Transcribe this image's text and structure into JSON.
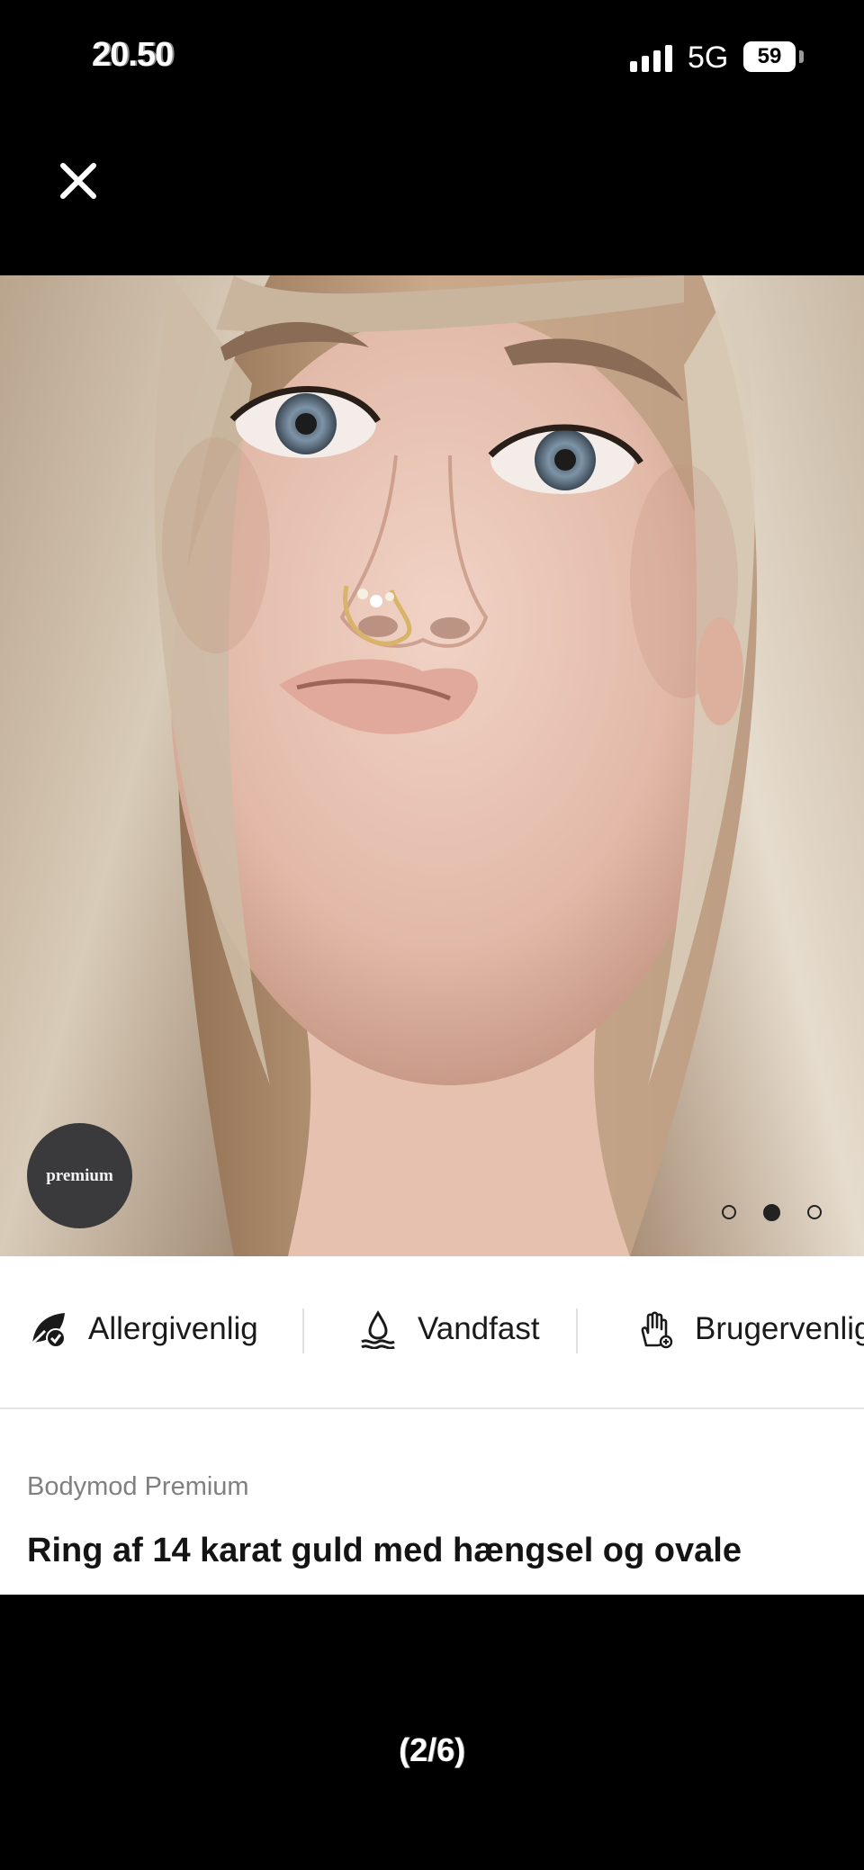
{
  "status_bar": {
    "time": "20.50",
    "network": "5G",
    "battery": "59"
  },
  "icons": {
    "close": "close-icon",
    "signal": "signal-icon",
    "battery": "battery-icon",
    "allergy": "leaf-check-icon",
    "water": "water-drop-icon",
    "hand": "hand-icon"
  },
  "gallery": {
    "badge_label": "premium",
    "current_index": 2,
    "total_dots": 3,
    "pager_label": "(2/6)"
  },
  "features": [
    {
      "label": "Allergivenlig",
      "icon": "leaf-check-icon"
    },
    {
      "label": "Vandfast",
      "icon": "water-drop-icon"
    },
    {
      "label": "Brugervenlig",
      "icon": "hand-icon"
    }
  ],
  "product": {
    "brand": "Bodymod Premium",
    "title": "Ring af 14 karat guld med hængsel og ovale"
  },
  "colors": {
    "background": "#000000",
    "panel": "#ffffff",
    "brand_text": "#808080",
    "badge": "#3a3a3c"
  }
}
